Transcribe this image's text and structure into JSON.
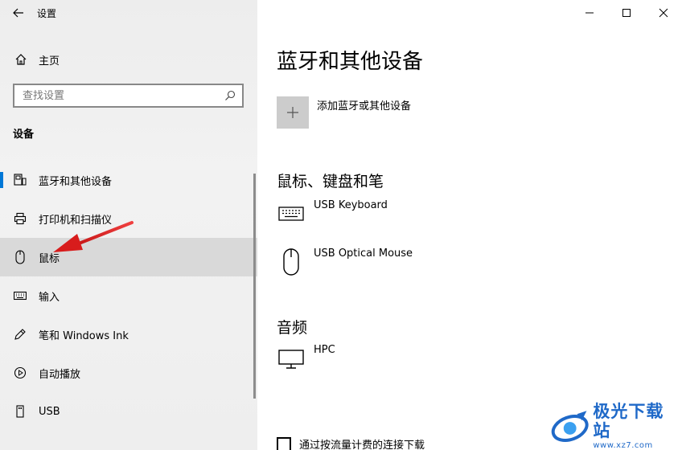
{
  "window": {
    "app_title": "设置"
  },
  "sidebar": {
    "home_label": "主页",
    "search_placeholder": "查找设置",
    "section_label": "设备",
    "items": [
      {
        "label": "蓝牙和其他设备",
        "icon": "bluetooth-device-icon",
        "selected": true
      },
      {
        "label": "打印机和扫描仪",
        "icon": "printer-icon"
      },
      {
        "label": "鼠标",
        "icon": "mouse-icon",
        "hovered": true
      },
      {
        "label": "输入",
        "icon": "keyboard-icon"
      },
      {
        "label": "笔和 Windows Ink",
        "icon": "pen-icon"
      },
      {
        "label": "自动播放",
        "icon": "autoplay-icon"
      },
      {
        "label": "USB",
        "icon": "usb-icon"
      }
    ]
  },
  "main": {
    "title": "蓝牙和其他设备",
    "add_device_label": "添加蓝牙或其他设备",
    "sections": [
      {
        "title": "鼠标、键盘和笔",
        "devices": [
          {
            "name": "USB Keyboard",
            "icon": "keyboard-icon"
          },
          {
            "name": "USB Optical Mouse",
            "icon": "mouse-icon"
          }
        ]
      },
      {
        "title": "音频",
        "devices": [
          {
            "name": "HPC",
            "icon": "monitor-icon"
          }
        ]
      }
    ],
    "metered_download_label": "通过按流量计费的连接下载"
  },
  "watermark": {
    "main_text": "极光下载站",
    "sub_text": "www.xz7.com"
  },
  "colors": {
    "accent": "#0078d7",
    "sidebar_bg": "#f0f0f0",
    "hover_bg": "#d9d9d9",
    "annotation_arrow": "#e02020",
    "watermark": "#1f69c8"
  }
}
